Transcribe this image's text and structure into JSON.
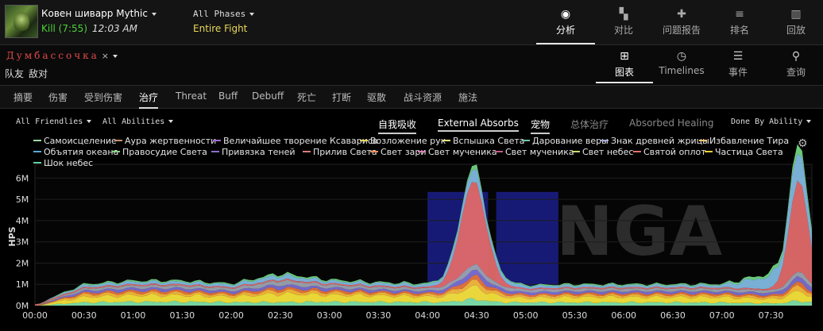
{
  "encounter": {
    "name": "Ковен шиварр Mythic",
    "result": "Kill (7:55)",
    "time": "12:03 AM"
  },
  "phase": {
    "label": "All Phases",
    "fight": "Entire Fight"
  },
  "top_nav": [
    {
      "label": "分析",
      "icon": "eye-icon",
      "glyph": "◉",
      "active": true
    },
    {
      "label": "对比",
      "icon": "compare-icon",
      "glyph": "▚",
      "active": false
    },
    {
      "label": "问题报告",
      "icon": "puzzle-icon",
      "glyph": "✚",
      "active": false
    },
    {
      "label": "排名",
      "icon": "rankings-icon",
      "glyph": "≡",
      "active": false
    },
    {
      "label": "回放",
      "icon": "replay-icon",
      "glyph": "▥",
      "active": false
    }
  ],
  "player": {
    "name": "Думбассочка",
    "close": "×"
  },
  "sides": [
    "队友",
    "敌对"
  ],
  "view_nav": [
    {
      "label": "图表",
      "icon": "grid-icon",
      "glyph": "⊞",
      "active": true
    },
    {
      "label": "Timelines",
      "icon": "clock-icon",
      "glyph": "◷",
      "active": false
    },
    {
      "label": "事件",
      "icon": "list-icon",
      "glyph": "☰",
      "active": false
    },
    {
      "label": "查询",
      "icon": "map-pin-icon",
      "glyph": "⚲",
      "active": false
    }
  ],
  "tabs": [
    "摘要",
    "伤害",
    "受到伤害",
    "治疗",
    "Threat",
    "Buff",
    "Debuff",
    "死亡",
    "打断",
    "驱散",
    "战斗资源",
    "施法"
  ],
  "active_tab": "治疗",
  "filters": {
    "friendlies": "All Friendlies",
    "abilities": "All Abilities",
    "group_by": "Done By Ability"
  },
  "view_toggles": [
    {
      "label": "自我吸收",
      "on": true
    },
    {
      "label": "External Absorbs",
      "on": true
    },
    {
      "label": "宠物",
      "on": true
    },
    {
      "label": "总体治疗",
      "on": false
    },
    {
      "label": "Absorbed Healing",
      "on": false
    }
  ],
  "colors": {
    "accent": "#e5e5e5",
    "kill": "#4cd13a",
    "fight": "#e8d85a",
    "player": "#e04a4a",
    "highlight": "#1b1f8a"
  },
  "chart_data": {
    "type": "area",
    "ylabel": "HPS",
    "stacked": true,
    "x_ticks": [
      "00:00",
      "00:30",
      "01:00",
      "01:30",
      "02:00",
      "02:30",
      "03:00",
      "03:30",
      "04:00",
      "04:30",
      "05:00",
      "05:30",
      "06:00",
      "06:30",
      "07:00",
      "07:30"
    ],
    "x_range_seconds": [
      0,
      475
    ],
    "y_ticks": [
      "0M",
      "1M",
      "2M",
      "3M",
      "4M",
      "5M",
      "6M"
    ],
    "ylim": [
      0,
      6.5
    ],
    "highlight_ranges_seconds": [
      [
        240,
        277
      ],
      [
        282,
        320
      ]
    ],
    "legend": [
      {
        "name": "Самоисцеление",
        "color": "#9fd8a6"
      },
      {
        "name": "Аура жертвенности",
        "color": "#c98f6b"
      },
      {
        "name": "Величайшее творение Ксавариса",
        "color": "#9c6bd1"
      },
      {
        "name": "Возложение рук",
        "color": "#e8d85a"
      },
      {
        "name": "Вспышка Света",
        "color": "#f2e47a"
      },
      {
        "name": "Дарование веры",
        "color": "#6ec6a8"
      },
      {
        "name": "Знак древней жрицы",
        "color": "#a6a6d9"
      },
      {
        "name": "Избавление Тира",
        "color": "#f0c66e"
      },
      {
        "name": "Объятия океана",
        "color": "#5aa9d6"
      },
      {
        "name": "Правосудие Света",
        "color": "#7fd37f"
      },
      {
        "name": "Привязка теней",
        "color": "#8a6fc9"
      },
      {
        "name": "Прилив Света",
        "color": "#e07a7a"
      },
      {
        "name": "Свет зари",
        "color": "#f08e5a"
      },
      {
        "name": "Свет мученика",
        "color": "#d97fb8"
      },
      {
        "name": "Свет мученика",
        "color": "#c95a8a"
      },
      {
        "name": "Свет небес",
        "color": "#c8e06a"
      },
      {
        "name": "Святой оплот",
        "color": "#e87070"
      },
      {
        "name": "Частица Света",
        "color": "#f5d03a"
      },
      {
        "name": "Шок небес",
        "color": "#5fd0a0"
      }
    ],
    "series": [
      {
        "name": "Самоисцеление",
        "color": "#7ee0a8",
        "values": [
          0,
          0.15,
          0.18,
          0.18,
          0.16,
          0.16,
          0.18,
          0.17,
          0.16,
          0.15,
          0.15,
          0.15,
          0.15,
          0.15,
          0.14,
          0.1
        ]
      },
      {
        "name": "Шок небес",
        "color": "#f5e13a",
        "values": [
          0,
          0.25,
          0.3,
          0.3,
          0.25,
          0.4,
          0.32,
          0.3,
          0.25,
          0.3,
          0.2,
          0.25,
          0.25,
          0.25,
          0.25,
          0.2
        ]
      },
      {
        "name": "Частица Света",
        "color": "#f5b83a",
        "values": [
          0,
          0.12,
          0.12,
          0.12,
          0.1,
          0.15,
          0.12,
          0.1,
          0.1,
          0.14,
          0.1,
          0.1,
          0.1,
          0.1,
          0.1,
          0.1
        ]
      },
      {
        "name": "Святой оплот",
        "color": "#e8743a",
        "values": [
          0,
          0.08,
          0.1,
          0.1,
          0.08,
          0.12,
          0.1,
          0.08,
          0.08,
          0.12,
          0.08,
          0.08,
          0.08,
          0.08,
          0.08,
          0.08
        ]
      },
      {
        "name": "Свет небес",
        "color": "#7a6fd1",
        "values": [
          0,
          0.1,
          0.12,
          0.12,
          0.1,
          0.15,
          0.12,
          0.1,
          0.1,
          0.15,
          0.1,
          0.1,
          0.1,
          0.1,
          0.1,
          0.12
        ]
      },
      {
        "name": "Свет мученика",
        "color": "#9ba3b0",
        "values": [
          0,
          0.1,
          0.12,
          0.12,
          0.12,
          0.2,
          0.14,
          0.12,
          0.12,
          0.15,
          0.12,
          0.12,
          0.12,
          0.12,
          0.12,
          0.12
        ]
      },
      {
        "name": "Прилив Света",
        "color": "#e06a6a",
        "values": [
          0,
          0.05,
          0.05,
          0.05,
          0.05,
          0.08,
          0.05,
          0.05,
          0.08,
          3.9,
          0.05,
          0.05,
          0.05,
          0.05,
          0.05,
          4.2
        ]
      },
      {
        "name": "Объятия океана",
        "color": "#7fb8e0",
        "values": [
          0,
          0.1,
          0.12,
          0.12,
          0.12,
          0.2,
          0.12,
          0.12,
          0.12,
          0.3,
          0.1,
          0.1,
          0.1,
          0.1,
          0.12,
          0.6
        ]
      },
      {
        "name": "Правосудие Света",
        "color": "#6fd37f",
        "values": [
          0,
          0.05,
          0.06,
          0.06,
          0.05,
          0.08,
          0.06,
          0.05,
          0.05,
          0.1,
          0.05,
          0.05,
          0.05,
          0.05,
          0.05,
          0.15
        ]
      }
    ]
  },
  "watermark": "NGA"
}
